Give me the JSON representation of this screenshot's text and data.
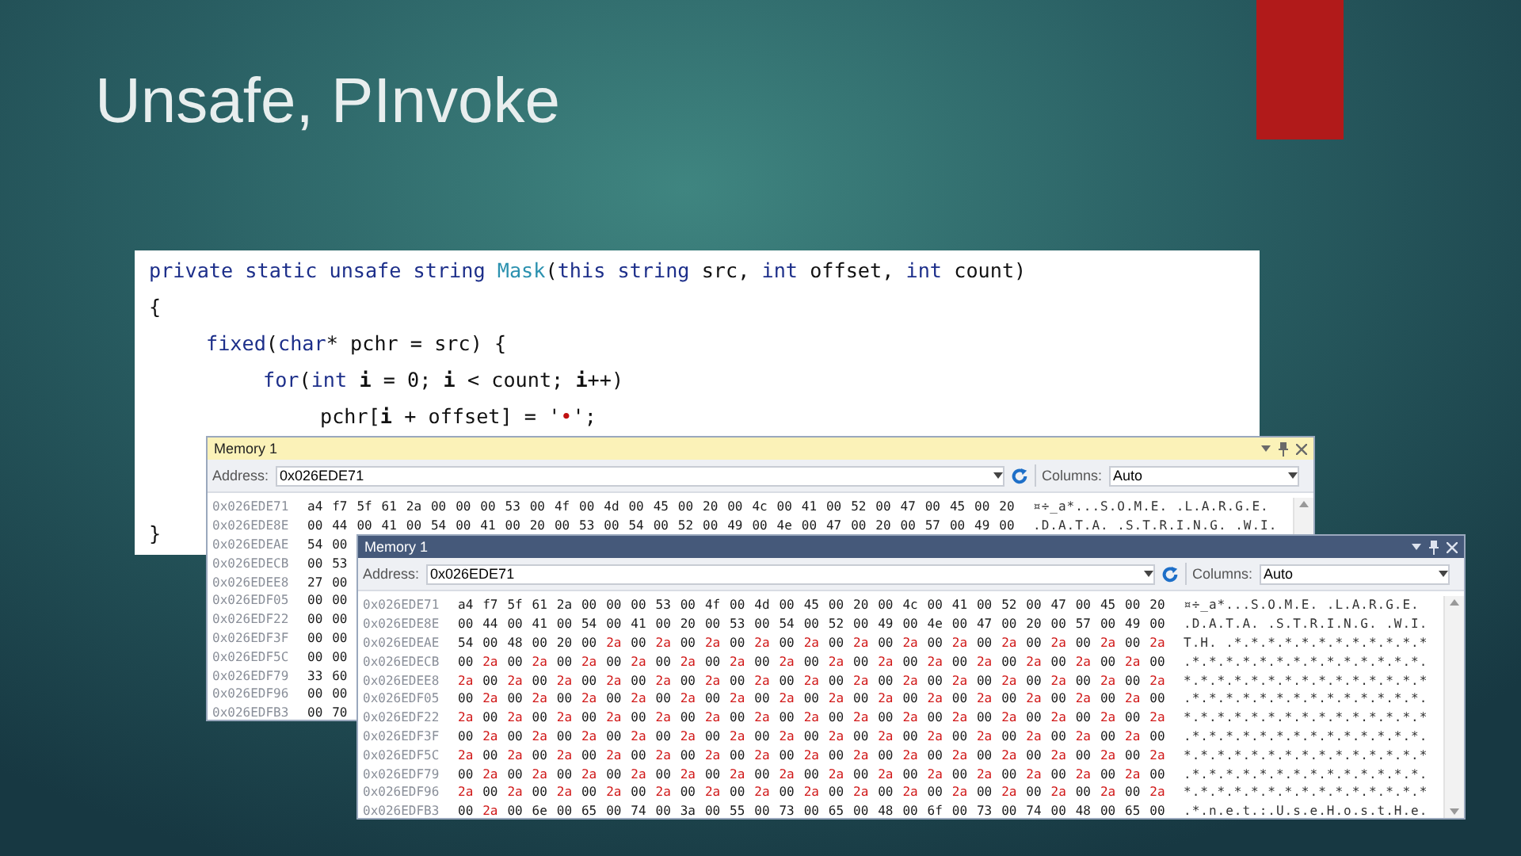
{
  "slide": {
    "title": "Unsafe, PInvoke"
  },
  "code": {
    "lines": [
      {
        "segments": [
          {
            "text": "private static unsafe string ",
            "kind": "keyword"
          },
          {
            "text": "Mask",
            "kind": "type"
          },
          {
            "text": "(",
            "kind": "plain"
          },
          {
            "text": "this string ",
            "kind": "keyword"
          },
          {
            "text": "src, ",
            "kind": "plain"
          },
          {
            "text": "int ",
            "kind": "keyword"
          },
          {
            "text": "offset, ",
            "kind": "plain"
          },
          {
            "text": "int ",
            "kind": "keyword"
          },
          {
            "text": "count)",
            "kind": "plain"
          }
        ]
      },
      {
        "segments": [
          {
            "text": "{",
            "kind": "plain"
          }
        ],
        "children": [
          {
            "segments": [
              {
                "text": "fixed",
                "kind": "keyword"
              },
              {
                "text": "(",
                "kind": "plain"
              },
              {
                "text": "char",
                "kind": "keyword"
              },
              {
                "text": "* pchr = src) {",
                "kind": "plain"
              }
            ],
            "children": [
              {
                "segments": [
                  {
                    "text": "for",
                    "kind": "keyword"
                  },
                  {
                    "text": "(",
                    "kind": "plain"
                  },
                  {
                    "text": "int ",
                    "kind": "keyword"
                  },
                  {
                    "text": "i",
                    "kind": "bold"
                  },
                  {
                    "text": " = 0; ",
                    "kind": "plain"
                  },
                  {
                    "text": "i",
                    "kind": "bold"
                  },
                  {
                    "text": " < count; ",
                    "kind": "plain"
                  },
                  {
                    "text": "i",
                    "kind": "bold"
                  },
                  {
                    "text": "++)",
                    "kind": "plain"
                  }
                ],
                "children": [
                  {
                    "segments": [
                      {
                        "text": "pchr[",
                        "kind": "plain"
                      },
                      {
                        "text": "i",
                        "kind": "bold"
                      },
                      {
                        "text": " + offset] = '",
                        "kind": "plain"
                      },
                      {
                        "text": "•",
                        "kind": "char"
                      },
                      {
                        "text": "';",
                        "kind": "plain"
                      }
                    ]
                  }
                ]
              }
            ]
          }
        ]
      },
      {
        "segments": [
          {
            "text": "}",
            "kind": "plain"
          }
        ]
      }
    ]
  },
  "windows": [
    {
      "title": "Memory 1",
      "active": true,
      "address_label": "Address:",
      "address": "0x026EDE71",
      "columns_label": "Columns:",
      "columns": "Auto",
      "rows": [
        {
          "address": "0x026EDE71",
          "cells": [
            "a4",
            "f7",
            "5f",
            "61",
            "2a",
            "00",
            "00",
            "00",
            "53",
            "00",
            "4f",
            "00",
            "4d",
            "00",
            "45",
            "00",
            "20",
            "00",
            "4c",
            "00",
            "41",
            "00",
            "52",
            "00",
            "47",
            "00",
            "45",
            "00",
            "20"
          ],
          "changed": [
            false,
            false,
            false,
            false,
            false,
            false,
            false,
            false,
            false,
            false,
            false,
            false,
            false,
            false,
            false,
            false,
            false,
            false,
            false,
            false,
            false,
            false,
            false,
            false,
            false,
            false,
            false,
            false,
            false
          ],
          "ascii": "¤÷_a*...S.O.M.E. .L.A.R.G.E. "
        },
        {
          "address": "0x026EDE8E",
          "cells": [
            "00",
            "44",
            "00",
            "41",
            "00",
            "54",
            "00",
            "41",
            "00",
            "20",
            "00",
            "53",
            "00",
            "54",
            "00",
            "52",
            "00",
            "49",
            "00",
            "4e",
            "00",
            "47",
            "00",
            "20",
            "00",
            "57",
            "00",
            "49",
            "00"
          ],
          "changed": [
            false,
            false,
            false,
            false,
            false,
            false,
            false,
            false,
            false,
            false,
            false,
            false,
            false,
            false,
            false,
            false,
            false,
            false,
            false,
            false,
            false,
            false,
            false,
            false,
            false,
            false,
            false,
            false,
            false
          ],
          "ascii": ".D.A.T.A. .S.T.R.I.N.G. .W.I."
        },
        {
          "address": "0x026EDEAE",
          "cells": [
            "54",
            "00"
          ],
          "changed": [
            false,
            false
          ]
        },
        {
          "address": "0x026EDECB",
          "cells": [
            "00",
            "53"
          ],
          "changed": [
            false,
            false
          ]
        },
        {
          "address": "0x026EDEE8",
          "cells": [
            "27",
            "00"
          ],
          "changed": [
            false,
            false
          ]
        },
        {
          "address": "0x026EDF05",
          "cells": [
            "00",
            "00"
          ],
          "changed": [
            false,
            false
          ]
        },
        {
          "address": "0x026EDF22",
          "cells": [
            "00",
            "00"
          ],
          "changed": [
            false,
            false
          ]
        },
        {
          "address": "0x026EDF3F",
          "cells": [
            "00",
            "00"
          ],
          "changed": [
            false,
            false
          ]
        },
        {
          "address": "0x026EDF5C",
          "cells": [
            "00",
            "00"
          ],
          "changed": [
            false,
            false
          ]
        },
        {
          "address": "0x026EDF79",
          "cells": [
            "33",
            "60"
          ],
          "changed": [
            false,
            false
          ]
        },
        {
          "address": "0x026EDF96",
          "cells": [
            "00",
            "00"
          ],
          "changed": [
            false,
            false
          ]
        },
        {
          "address": "0x026EDFB3",
          "cells": [
            "00",
            "70"
          ],
          "changed": [
            false,
            false
          ]
        }
      ]
    },
    {
      "title": "Memory 1",
      "active": false,
      "address_label": "Address:",
      "address": "0x026EDE71",
      "columns_label": "Columns:",
      "columns": "Auto",
      "rows": [
        {
          "address": "0x026EDE71",
          "cells": [
            "a4",
            "f7",
            "5f",
            "61",
            "2a",
            "00",
            "00",
            "00",
            "53",
            "00",
            "4f",
            "00",
            "4d",
            "00",
            "45",
            "00",
            "20",
            "00",
            "4c",
            "00",
            "41",
            "00",
            "52",
            "00",
            "47",
            "00",
            "45",
            "00",
            "20"
          ],
          "changed": [
            false,
            false,
            false,
            false,
            false,
            false,
            false,
            false,
            false,
            false,
            false,
            false,
            false,
            false,
            false,
            false,
            false,
            false,
            false,
            false,
            false,
            false,
            false,
            false,
            false,
            false,
            false,
            false,
            false
          ],
          "ascii": "¤÷_a*...S.O.M.E. .L.A.R.G.E. "
        },
        {
          "address": "0x026EDE8E",
          "cells": [
            "00",
            "44",
            "00",
            "41",
            "00",
            "54",
            "00",
            "41",
            "00",
            "20",
            "00",
            "53",
            "00",
            "54",
            "00",
            "52",
            "00",
            "49",
            "00",
            "4e",
            "00",
            "47",
            "00",
            "20",
            "00",
            "57",
            "00",
            "49",
            "00"
          ],
          "changed": [
            false,
            false,
            false,
            false,
            false,
            false,
            false,
            false,
            false,
            false,
            false,
            false,
            false,
            false,
            false,
            false,
            false,
            false,
            false,
            false,
            false,
            false,
            false,
            false,
            false,
            false,
            false,
            false,
            false
          ],
          "ascii": ".D.A.T.A. .S.T.R.I.N.G. .W.I."
        },
        {
          "address": "0x026EDEAE",
          "cells": [
            "54",
            "00",
            "48",
            "00",
            "20",
            "00",
            "2a",
            "00",
            "2a",
            "00",
            "2a",
            "00",
            "2a",
            "00",
            "2a",
            "00",
            "2a",
            "00",
            "2a",
            "00",
            "2a",
            "00",
            "2a",
            "00",
            "2a",
            "00",
            "2a",
            "00",
            "2a"
          ],
          "changed": [
            false,
            false,
            false,
            false,
            false,
            false,
            true,
            false,
            true,
            false,
            true,
            false,
            true,
            false,
            true,
            false,
            true,
            false,
            true,
            false,
            true,
            false,
            true,
            false,
            true,
            false,
            true,
            false,
            true
          ],
          "ascii": "T.H. .*.*.*.*.*.*.*.*.*.*.*.*"
        },
        {
          "address": "0x026EDECB",
          "cells": [
            "00",
            "2a",
            "00",
            "2a",
            "00",
            "2a",
            "00",
            "2a",
            "00",
            "2a",
            "00",
            "2a",
            "00",
            "2a",
            "00",
            "2a",
            "00",
            "2a",
            "00",
            "2a",
            "00",
            "2a",
            "00",
            "2a",
            "00",
            "2a",
            "00",
            "2a",
            "00"
          ],
          "changed": [
            false,
            true,
            false,
            true,
            false,
            true,
            false,
            true,
            false,
            true,
            false,
            true,
            false,
            true,
            false,
            true,
            false,
            true,
            false,
            true,
            false,
            true,
            false,
            true,
            false,
            true,
            false,
            true,
            false
          ],
          "ascii": ".*.*.*.*.*.*.*.*.*.*.*.*.*.*."
        },
        {
          "address": "0x026EDEE8",
          "cells": [
            "2a",
            "00",
            "2a",
            "00",
            "2a",
            "00",
            "2a",
            "00",
            "2a",
            "00",
            "2a",
            "00",
            "2a",
            "00",
            "2a",
            "00",
            "2a",
            "00",
            "2a",
            "00",
            "2a",
            "00",
            "2a",
            "00",
            "2a",
            "00",
            "2a",
            "00",
            "2a"
          ],
          "changed": [
            true,
            false,
            true,
            false,
            true,
            false,
            true,
            false,
            true,
            false,
            true,
            false,
            true,
            false,
            true,
            false,
            true,
            false,
            true,
            false,
            true,
            false,
            true,
            false,
            true,
            false,
            true,
            false,
            true
          ],
          "ascii": "*.*.*.*.*.*.*.*.*.*.*.*.*.*.*"
        },
        {
          "address": "0x026EDF05",
          "cells": [
            "00",
            "2a",
            "00",
            "2a",
            "00",
            "2a",
            "00",
            "2a",
            "00",
            "2a",
            "00",
            "2a",
            "00",
            "2a",
            "00",
            "2a",
            "00",
            "2a",
            "00",
            "2a",
            "00",
            "2a",
            "00",
            "2a",
            "00",
            "2a",
            "00",
            "2a",
            "00"
          ],
          "changed": [
            false,
            true,
            false,
            true,
            false,
            true,
            false,
            true,
            false,
            true,
            false,
            true,
            false,
            true,
            false,
            true,
            false,
            true,
            false,
            true,
            false,
            true,
            false,
            true,
            false,
            true,
            false,
            true,
            false
          ],
          "ascii": ".*.*.*.*.*.*.*.*.*.*.*.*.*.*."
        },
        {
          "address": "0x026EDF22",
          "cells": [
            "2a",
            "00",
            "2a",
            "00",
            "2a",
            "00",
            "2a",
            "00",
            "2a",
            "00",
            "2a",
            "00",
            "2a",
            "00",
            "2a",
            "00",
            "2a",
            "00",
            "2a",
            "00",
            "2a",
            "00",
            "2a",
            "00",
            "2a",
            "00",
            "2a",
            "00",
            "2a"
          ],
          "changed": [
            true,
            false,
            true,
            false,
            true,
            false,
            true,
            false,
            true,
            false,
            true,
            false,
            true,
            false,
            true,
            false,
            true,
            false,
            true,
            false,
            true,
            false,
            true,
            false,
            true,
            false,
            true,
            false,
            true
          ],
          "ascii": "*.*.*.*.*.*.*.*.*.*.*.*.*.*.*"
        },
        {
          "address": "0x026EDF3F",
          "cells": [
            "00",
            "2a",
            "00",
            "2a",
            "00",
            "2a",
            "00",
            "2a",
            "00",
            "2a",
            "00",
            "2a",
            "00",
            "2a",
            "00",
            "2a",
            "00",
            "2a",
            "00",
            "2a",
            "00",
            "2a",
            "00",
            "2a",
            "00",
            "2a",
            "00",
            "2a",
            "00"
          ],
          "changed": [
            false,
            true,
            false,
            true,
            false,
            true,
            false,
            true,
            false,
            true,
            false,
            true,
            false,
            true,
            false,
            true,
            false,
            true,
            false,
            true,
            false,
            true,
            false,
            true,
            false,
            true,
            false,
            true,
            false
          ],
          "ascii": ".*.*.*.*.*.*.*.*.*.*.*.*.*.*."
        },
        {
          "address": "0x026EDF5C",
          "cells": [
            "2a",
            "00",
            "2a",
            "00",
            "2a",
            "00",
            "2a",
            "00",
            "2a",
            "00",
            "2a",
            "00",
            "2a",
            "00",
            "2a",
            "00",
            "2a",
            "00",
            "2a",
            "00",
            "2a",
            "00",
            "2a",
            "00",
            "2a",
            "00",
            "2a",
            "00",
            "2a"
          ],
          "changed": [
            true,
            false,
            true,
            false,
            true,
            false,
            true,
            false,
            true,
            false,
            true,
            false,
            true,
            false,
            true,
            false,
            true,
            false,
            true,
            false,
            true,
            false,
            true,
            false,
            true,
            false,
            true,
            false,
            true
          ],
          "ascii": "*.*.*.*.*.*.*.*.*.*.*.*.*.*.*"
        },
        {
          "address": "0x026EDF79",
          "cells": [
            "00",
            "2a",
            "00",
            "2a",
            "00",
            "2a",
            "00",
            "2a",
            "00",
            "2a",
            "00",
            "2a",
            "00",
            "2a",
            "00",
            "2a",
            "00",
            "2a",
            "00",
            "2a",
            "00",
            "2a",
            "00",
            "2a",
            "00",
            "2a",
            "00",
            "2a",
            "00"
          ],
          "changed": [
            false,
            true,
            false,
            true,
            false,
            true,
            false,
            true,
            false,
            true,
            false,
            true,
            false,
            true,
            false,
            true,
            false,
            true,
            false,
            true,
            false,
            true,
            false,
            true,
            false,
            true,
            false,
            true,
            false
          ],
          "ascii": ".*.*.*.*.*.*.*.*.*.*.*.*.*.*."
        },
        {
          "address": "0x026EDF96",
          "cells": [
            "2a",
            "00",
            "2a",
            "00",
            "2a",
            "00",
            "2a",
            "00",
            "2a",
            "00",
            "2a",
            "00",
            "2a",
            "00",
            "2a",
            "00",
            "2a",
            "00",
            "2a",
            "00",
            "2a",
            "00",
            "2a",
            "00",
            "2a",
            "00",
            "2a",
            "00",
            "2a"
          ],
          "changed": [
            true,
            false,
            true,
            false,
            true,
            false,
            true,
            false,
            true,
            false,
            true,
            false,
            true,
            false,
            true,
            false,
            true,
            false,
            true,
            false,
            true,
            false,
            true,
            false,
            true,
            false,
            true,
            false,
            true
          ],
          "ascii": "*.*.*.*.*.*.*.*.*.*.*.*.*.*.*"
        },
        {
          "address": "0x026EDFB3",
          "cells": [
            "00",
            "2a",
            "00",
            "6e",
            "00",
            "65",
            "00",
            "74",
            "00",
            "3a",
            "00",
            "55",
            "00",
            "73",
            "00",
            "65",
            "00",
            "48",
            "00",
            "6f",
            "00",
            "73",
            "00",
            "74",
            "00",
            "48",
            "00",
            "65",
            "00"
          ],
          "changed": [
            false,
            true,
            false,
            false,
            false,
            false,
            false,
            false,
            false,
            false,
            false,
            false,
            false,
            false,
            false,
            false,
            false,
            false,
            false,
            false,
            false,
            false,
            false,
            false,
            false,
            false,
            false,
            false,
            false
          ],
          "ascii": ".*.n.e.t.:.U.s.e.H.o.s.t.H.e."
        }
      ]
    }
  ]
}
